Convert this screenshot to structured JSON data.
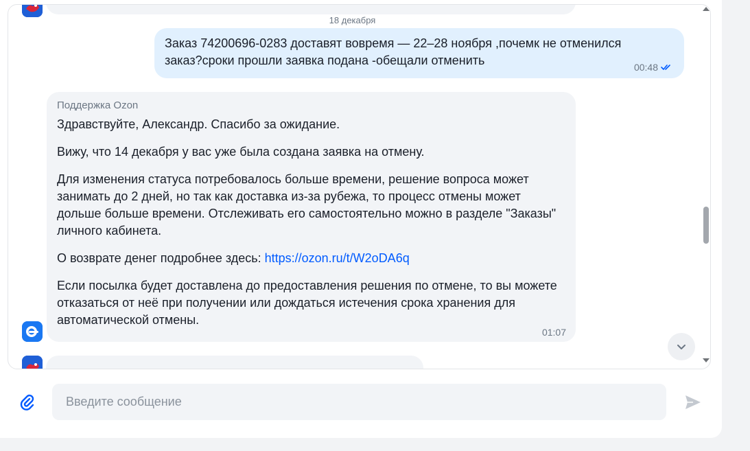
{
  "chat": {
    "date_separator": "18 декабря",
    "outgoing": {
      "text": "Заказ 74200696-0283 доставят вовремя — 22–28 ноября ,почемк не отменился заказ?сроки прошли заявка подана -обещали отменить",
      "time": "00:48"
    },
    "incoming": {
      "sender": "Поддержка Ozon",
      "p1": "Здравствуйте, Александр. Спасибо за ожидание.",
      "p2": "Вижу, что 14 декабря у вас уже была создана заявка на отмену.",
      "p3": "Для изменения статуса потребовалось больше времени, решение вопроса может занимать до 2 дней, но так как доставка из-за рубежа, то процесс отмены может дольше больше времени. Отслеживать его самостоятельно можно в разделе \"Заказы\" личного кабинета.",
      "p4_prefix": "О возврате денег подробнее здесь: ",
      "p4_link": "https://ozon.ru/t/W2oDA6q",
      "p5": "Если посылка будет доставлена до предоставления решения по отмене, то вы можете отказаться от неё при получении или дождаться истечения срока хранения для автоматической отмены.",
      "time": "01:07"
    }
  },
  "composer": {
    "placeholder": "Введите сообщение"
  },
  "colors": {
    "outgoing_bubble": "#e1f0fe",
    "incoming_bubble": "#f2f4f7",
    "link": "#005bff",
    "accent": "#005bff"
  }
}
